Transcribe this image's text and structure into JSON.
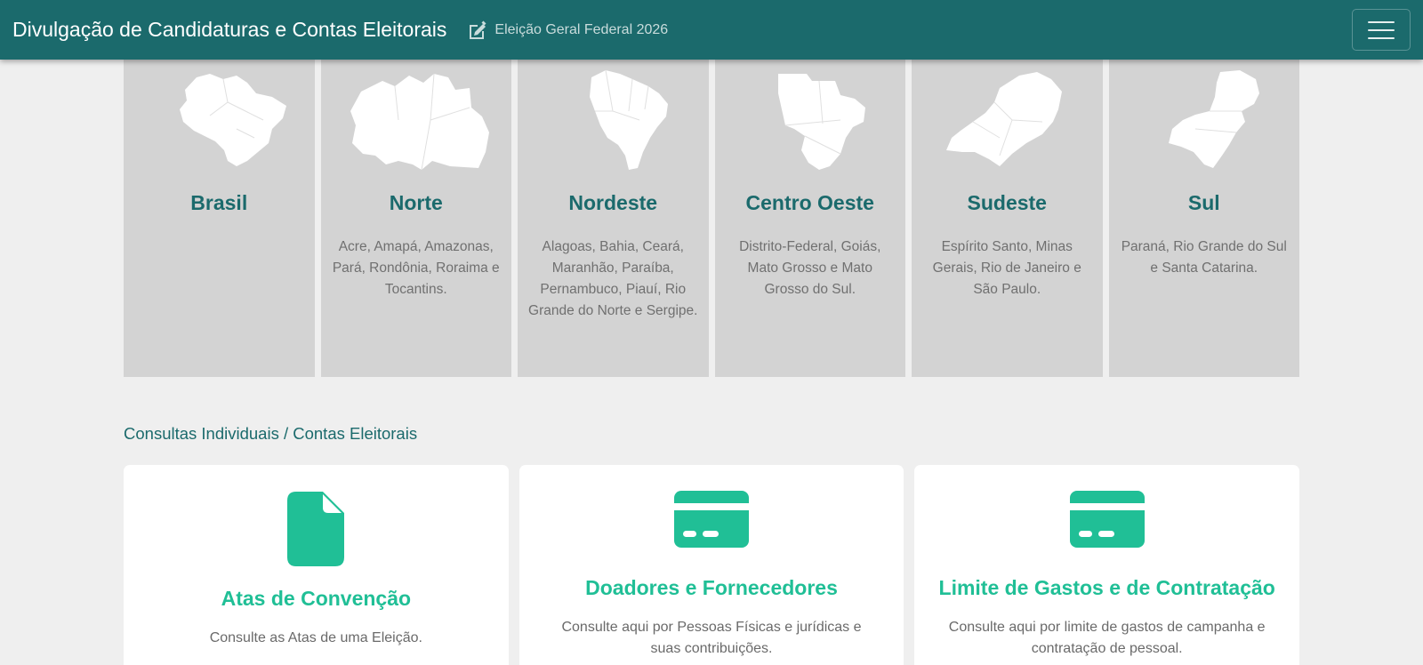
{
  "header": {
    "brand": "Divulgação de Candidaturas e Contas Eleitorais",
    "election": "Eleição Geral Federal 2026",
    "edit_icon": "edit-icon",
    "menu_icon": "hamburger-menu-icon",
    "color": "#1b6a6c"
  },
  "regions": [
    {
      "name": "Brasil",
      "states": ""
    },
    {
      "name": "Norte",
      "states": "Acre, Amapá, Amazonas, Pará, Rondônia, Roraima e Tocantins."
    },
    {
      "name": "Nordeste",
      "states": "Alagoas, Bahia, Ceará, Maranhão, Paraíba, Pernambuco, Piauí, Rio Grande do Norte e Sergipe."
    },
    {
      "name": "Centro Oeste",
      "states": "Distrito-Federal, Goiás, Mato Grosso e Mato Grosso do Sul."
    },
    {
      "name": "Sudeste",
      "states": "Espírito Santo, Minas Gerais, Rio de Janeiro e São Paulo."
    },
    {
      "name": "Sul",
      "states": "Paraná, Rio Grande do Sul e Santa Catarina."
    }
  ],
  "section": {
    "breadcrumb": "Consultas Individuais / Contas Eleitorais"
  },
  "cards": [
    {
      "icon": "document-icon",
      "title": "Atas de Convenção",
      "desc": "Consulte as Atas de uma Eleição."
    },
    {
      "icon": "credit-card-icon",
      "title": "Doadores e Fornecedores",
      "desc": "Consulte aqui por Pessoas Físicas e jurídicas e suas contribuições."
    },
    {
      "icon": "credit-card-icon",
      "title": "Limite de Gastos e de Contratação",
      "desc": "Consulte aqui por limite de gastos de campanha e contratação de pessoal."
    }
  ],
  "colors": {
    "accent": "#20bf96",
    "region_bg": "#d3d3d3",
    "page_bg": "#efefef"
  }
}
